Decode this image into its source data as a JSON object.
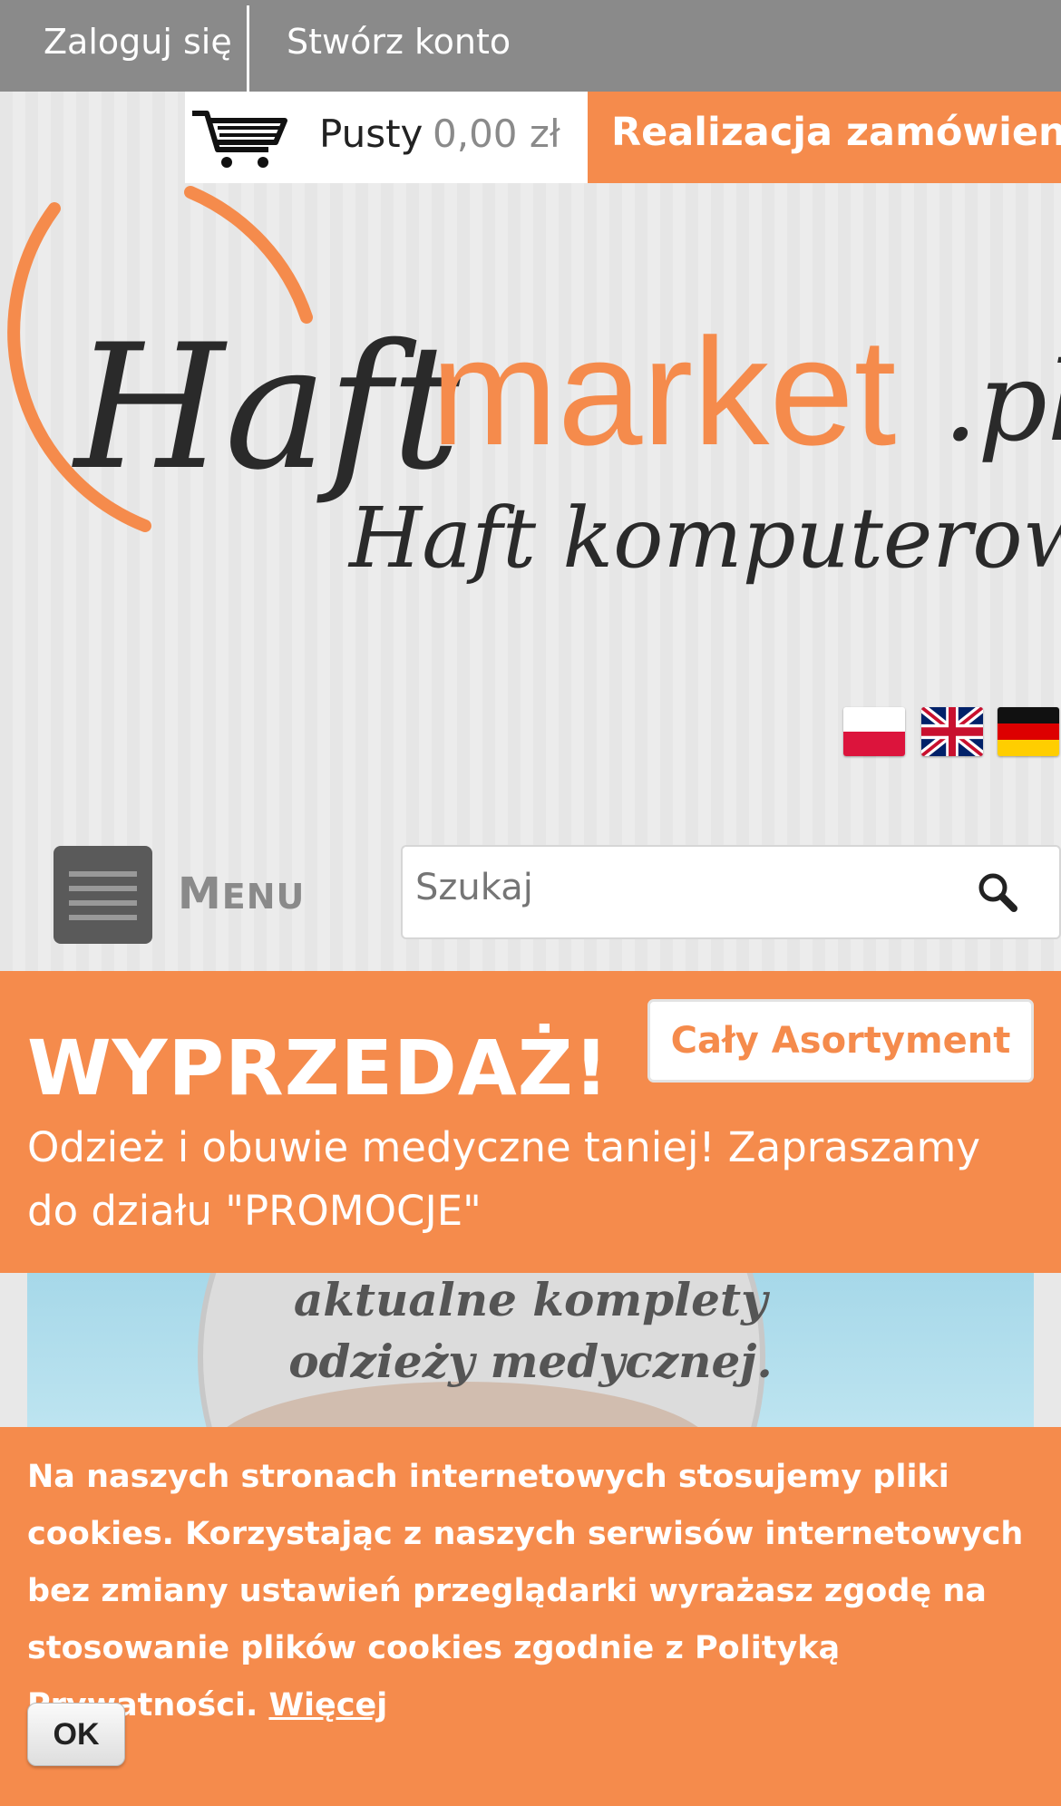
{
  "topbar": {
    "login": "Zaloguj się",
    "register": "Stwórz konto"
  },
  "cart": {
    "status": "Pusty",
    "amount": "0,00 zł",
    "icon": "cart-icon"
  },
  "checkout": {
    "label": "Realizacja zamówienia"
  },
  "logo": {
    "part1": "Haft",
    "part2": "market",
    "part3": ".pl",
    "tagline": "Haft komputerowy"
  },
  "languages": [
    "pl-flag-icon",
    "en-flag-icon",
    "de-flag-icon"
  ],
  "menu": {
    "label_first": "M",
    "label_rest": "ENU"
  },
  "search": {
    "placeholder": "Szukaj",
    "icon": "search-icon"
  },
  "promo": {
    "headline": "WYPRZEDAŻ!",
    "button": "Cały Asortyment",
    "description": "Odzież i obuwie medyczne taniej! Zapraszamy do działu \"PROMOCJE\""
  },
  "banner": {
    "line1": "aktualne komplety",
    "line2": "odzieży medycznej."
  },
  "cookie": {
    "text": "Na naszych stronach internetowych stosujemy pliki cookies. Korzystając z naszych serwisów internetowych bez zmiany ustawień przeglądarki wyrażasz zgodę na stosowanie plików cookies zgodnie z Polityką Prywatności.",
    "more": "Więcej",
    "ok": "OK"
  },
  "colors": {
    "accent": "#f58b4c",
    "topbar": "#8a8a8a",
    "logo_dark": "#2a2a2a"
  }
}
